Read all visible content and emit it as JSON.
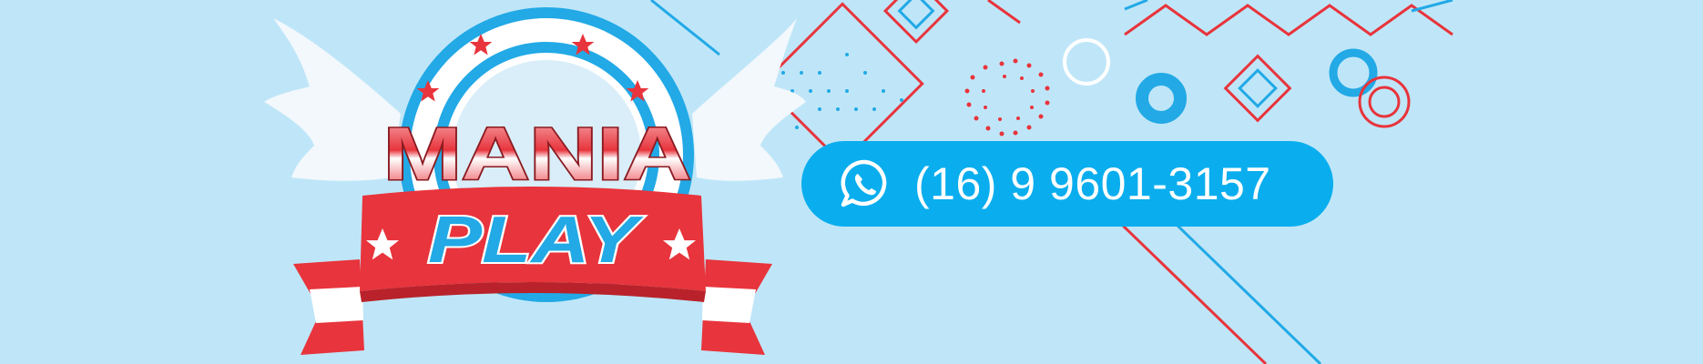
{
  "logo": {
    "word_top": "MANIA",
    "word_bottom": "PLAY",
    "brand_red": "#e8343c",
    "brand_blue": "#22a9e6"
  },
  "contact": {
    "icon": "whatsapp-icon",
    "phone": "(16) 9 9601-3157",
    "pill_color": "#0aaeee"
  },
  "background": {
    "color": "#bfe6f8",
    "decoration_colors": [
      "#e8343c",
      "#22a9e6",
      "#ffffff"
    ]
  }
}
